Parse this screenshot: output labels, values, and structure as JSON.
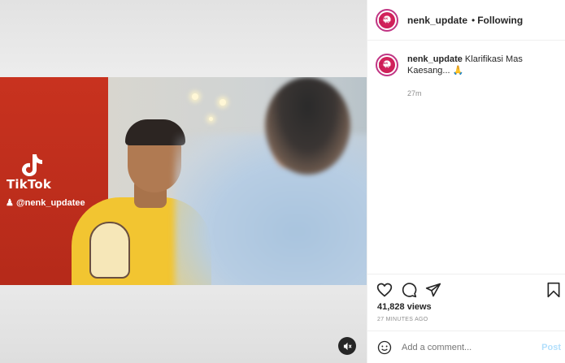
{
  "post": {
    "username": "nenk_update",
    "separator": "•",
    "follow_status": "Following",
    "avatar_text": "NENK UPDATE"
  },
  "caption": {
    "username": "nenk_update",
    "text": "Klarifikasi Mas Kaesang... 🙏",
    "time": "27m"
  },
  "video": {
    "watermark_brand": "TikTok",
    "watermark_handle": "@nenk_updatee"
  },
  "stats": {
    "views": "41,828 views",
    "posted": "27 MINUTES AGO"
  },
  "comment_box": {
    "placeholder": "Add a comment...",
    "post_label": "Post"
  },
  "colors": {
    "accent_link": "#b2dffc",
    "muted_text": "#8e8e8e",
    "story_ring": "#c13584"
  },
  "icons": [
    "like-icon",
    "comment-icon",
    "share-icon",
    "save-icon",
    "emoji-icon",
    "mute-icon",
    "tiktok-icon",
    "user-icon"
  ]
}
